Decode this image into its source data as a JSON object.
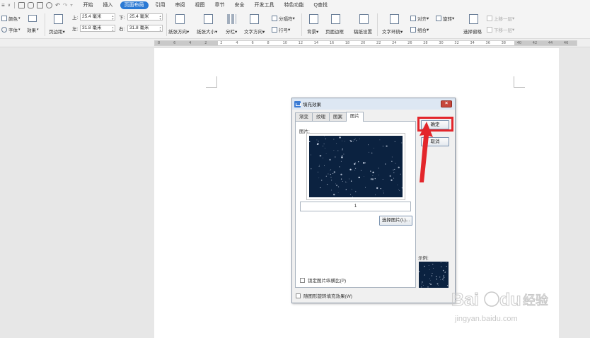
{
  "menubar": {
    "quick_access": [
      "save-icon",
      "print-preview-icon",
      "print-icon",
      "preview-icon",
      "undo-icon",
      "redo-icon",
      "dropdown-icon"
    ],
    "tabs": [
      {
        "label": "开始",
        "active": false
      },
      {
        "label": "插入",
        "active": false
      },
      {
        "label": "页面布局",
        "active": true
      },
      {
        "label": "引用",
        "active": false
      },
      {
        "label": "审阅",
        "active": false
      },
      {
        "label": "视图",
        "active": false
      },
      {
        "label": "章节",
        "active": false
      },
      {
        "label": "安全",
        "active": false
      },
      {
        "label": "开发工具",
        "active": false
      },
      {
        "label": "特色功能",
        "active": false
      },
      {
        "label": "Q查找",
        "active": false
      }
    ]
  },
  "ribbon": {
    "theme_color": "颜色",
    "theme_font": "字体",
    "theme_effect": "效果",
    "margins": "页边距",
    "top_label": "上:",
    "top_value": "25.4 毫米",
    "bottom_label": "下:",
    "bottom_value": "25.4 毫米",
    "left_label": "左:",
    "left_value": "31.8 毫米",
    "right_label": "右:",
    "right_value": "31.8 毫米",
    "orientation": "纸张方向",
    "paper_size": "纸张大小",
    "columns": "分栏",
    "text_direction": "文字方向",
    "line_numbers": "行号",
    "breaks": "分隔符",
    "background": "背景",
    "page_border": "页面边框",
    "paper_setup": "稿纸设置",
    "text_wrap": "文字环绕",
    "align": "对齐",
    "rotate": "旋转",
    "group": "组合",
    "selection_pane": "选择窗格",
    "bring_forward": "上移一层",
    "send_backward": "下移一层"
  },
  "ruler": {
    "ticks": [
      "8",
      "6",
      "4",
      "2",
      "2",
      "4",
      "6",
      "8",
      "10",
      "12",
      "14",
      "16",
      "18",
      "20",
      "22",
      "24",
      "26",
      "28",
      "30",
      "32",
      "34",
      "36",
      "38",
      "40",
      "42",
      "44",
      "46"
    ]
  },
  "dialog": {
    "title": "填充效果",
    "close_label": "×",
    "tabs": [
      {
        "label": "渐变",
        "active": false
      },
      {
        "label": "纹理",
        "active": false
      },
      {
        "label": "图案",
        "active": false
      },
      {
        "label": "图片",
        "active": true
      }
    ],
    "picture_label": "图片:",
    "page_number": "1",
    "select_picture_button": "选择图片(L)...",
    "lock_aspect_label": "锁定图片纵横比(P)",
    "rotate_with_shape_label": "随图形旋转填充效果(W)",
    "ok_button": "确定",
    "cancel_button": "取消",
    "sample_label": "示例:"
  },
  "colors": {
    "accent": "#2b79d4",
    "highlight": "#e3262b",
    "night_sky": "#0b2240"
  },
  "watermark": {
    "brand": "Baidu",
    "subbrand": "经验",
    "url": "jingyan.baidu.com"
  }
}
